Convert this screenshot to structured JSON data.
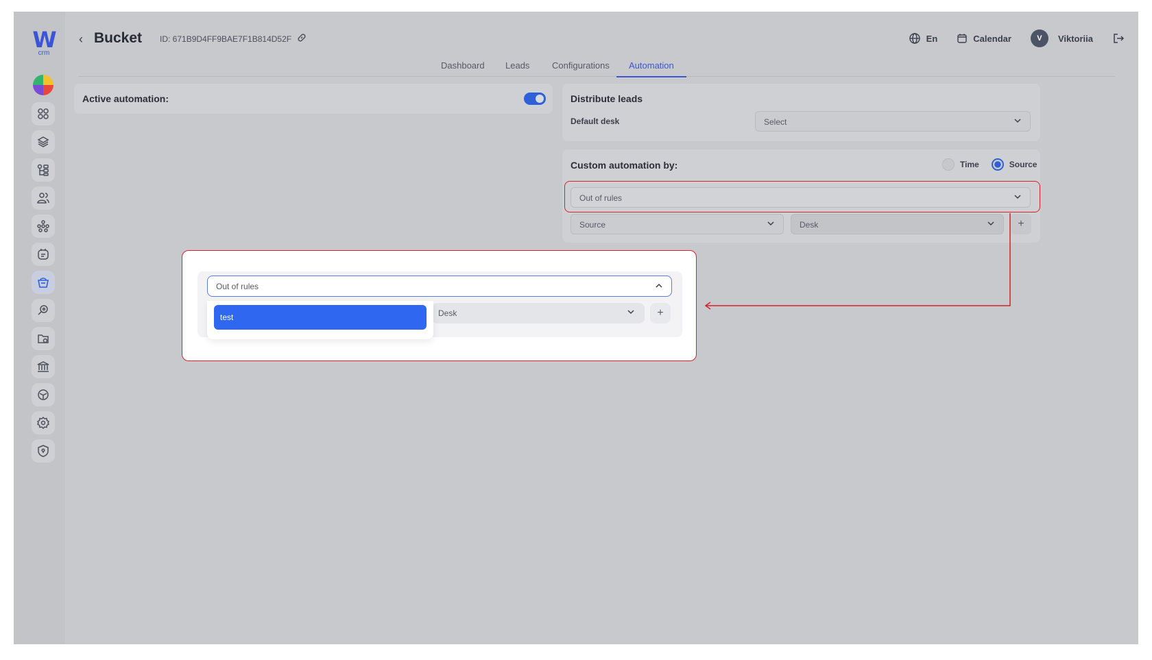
{
  "brand": {
    "logo_letter": "W",
    "logo_sub": "crm"
  },
  "header": {
    "title": "Bucket",
    "id_text": "ID: 671B9D4FF9BAE7F1B814D52F",
    "language": "En",
    "calendar_label": "Calendar",
    "user_initial": "V",
    "user_name": "Viktoriia"
  },
  "tabs": [
    {
      "label": "Dashboard",
      "active": false
    },
    {
      "label": "Leads",
      "active": false
    },
    {
      "label": "Configurations",
      "active": false
    },
    {
      "label": "Automation",
      "active": true
    }
  ],
  "active_automation": {
    "label": "Active automation:",
    "enabled": true
  },
  "distribute_leads": {
    "title": "Distribute leads",
    "default_desk_label": "Default desk",
    "default_desk_placeholder": "Select"
  },
  "custom_automation": {
    "title": "Custom automation by:",
    "options": [
      "Time",
      "Source"
    ],
    "selected": "Source",
    "rule_select_value": "Out of rules",
    "source_placeholder": "Source",
    "desk_placeholder": "Desk",
    "add_symbol": "+"
  },
  "zoom_callout": {
    "input_value": "Out of rules",
    "dropdown_options": [
      "test"
    ],
    "desk_placeholder": "Desk",
    "add_symbol": "+"
  },
  "sidebar_icons": [
    "dashboard-icon",
    "layers-icon",
    "hierarchy-icon",
    "users-icon",
    "network-icon",
    "notes-icon",
    "bucket-icon",
    "search-key-icon",
    "folder-icon",
    "bank-icon",
    "box-icon",
    "settings-icon",
    "shield-icon"
  ],
  "colors": {
    "accent": "#2f5fd9",
    "highlight": "#d3232b",
    "option_bg": "#2f67f0"
  }
}
